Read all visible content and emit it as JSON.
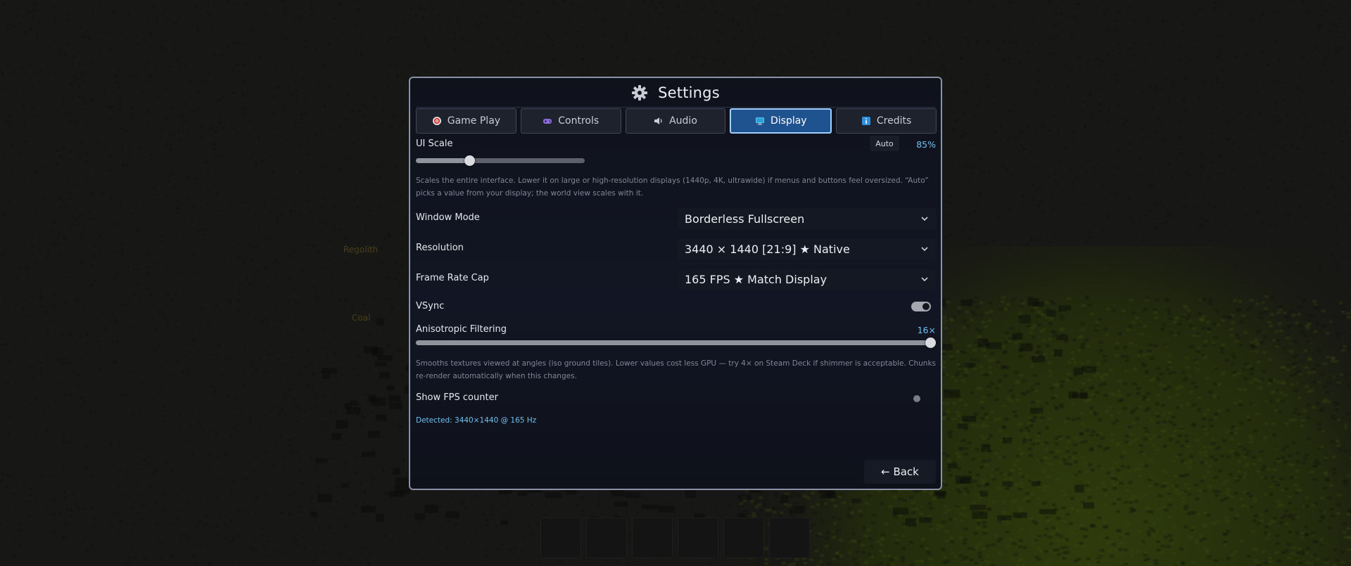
{
  "world": {
    "labels": [
      "Regolith",
      "Coal"
    ],
    "hotbar_slots": 6
  },
  "settings": {
    "title": "Settings",
    "tabs": [
      {
        "label": "Game Play",
        "icon": "target-icon",
        "active": false
      },
      {
        "label": "Controls",
        "icon": "gamepad-icon",
        "active": false
      },
      {
        "label": "Audio",
        "icon": "speaker-icon",
        "active": false
      },
      {
        "label": "Display",
        "icon": "monitor-icon",
        "active": true
      },
      {
        "label": "Credits",
        "icon": "info-icon",
        "active": false
      }
    ],
    "ui_scale": {
      "label": "UI Scale",
      "auto_label": "Auto",
      "value_text": "85%",
      "slider_fraction": 0.32,
      "description": "Scales the entire interface. Lower it on large or high-resolution displays (1440p, 4K, ultrawide) if menus and buttons feel oversized. “Auto” picks a value from your display; the world view scales with it."
    },
    "window_mode": {
      "label": "Window Mode",
      "value": "Borderless Fullscreen"
    },
    "resolution": {
      "label": "Resolution",
      "value": "3440 × 1440  [21:9]  ★ Native"
    },
    "frame_rate_cap": {
      "label": "Frame Rate Cap",
      "value": "165 FPS  ★ Match Display"
    },
    "vsync": {
      "label": "VSync",
      "enabled": true
    },
    "anisotropic": {
      "label": "Anisotropic Filtering",
      "value_text": "16×",
      "slider_fraction": 1.0,
      "description": "Smooths textures viewed at angles (iso ground tiles). Lower values cost less GPU — try 4× on Steam Deck if shimmer is acceptable. Chunks re-render automatically when this changes."
    },
    "fps_counter": {
      "label": "Show FPS counter",
      "enabled": false
    },
    "detected": "Detected: 3440×1440 @ 165 Hz",
    "back_label": "← Back"
  },
  "colors": {
    "accent": "#6fc0f2",
    "active_tab": "#1f5390",
    "panel_border": "#8c93a8"
  }
}
